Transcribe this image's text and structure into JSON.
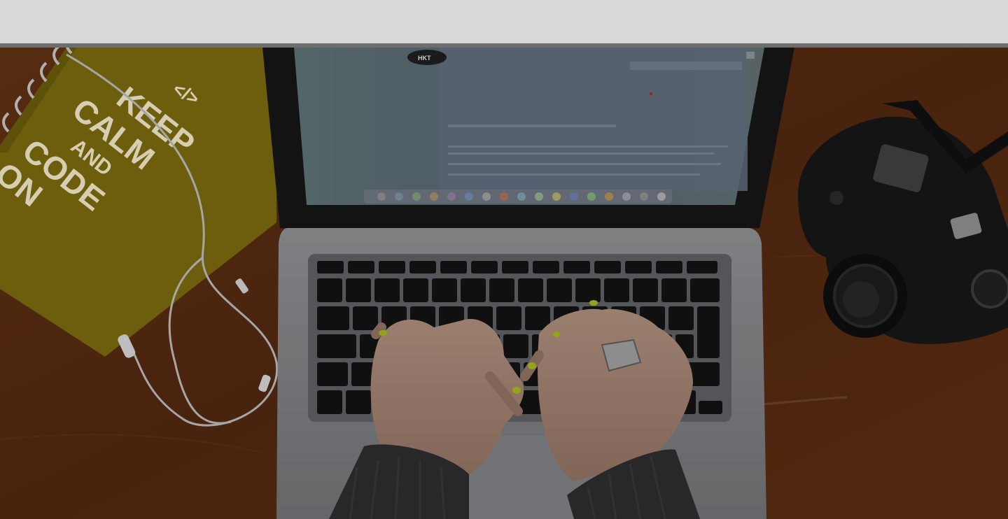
{
  "header": {
    "title": ""
  },
  "hero": {
    "notebook": {
      "line1": "KEEP",
      "line2": "CALM",
      "line3": "AND",
      "line4": "CODE",
      "line5": "ON",
      "symbol": "</>"
    },
    "screen_logo": "HKT"
  },
  "colors": {
    "topbar": "#d9d9d9",
    "divider": "#6e6e6e",
    "desk": "#5a2f12",
    "notebook": "#7a6a10"
  }
}
